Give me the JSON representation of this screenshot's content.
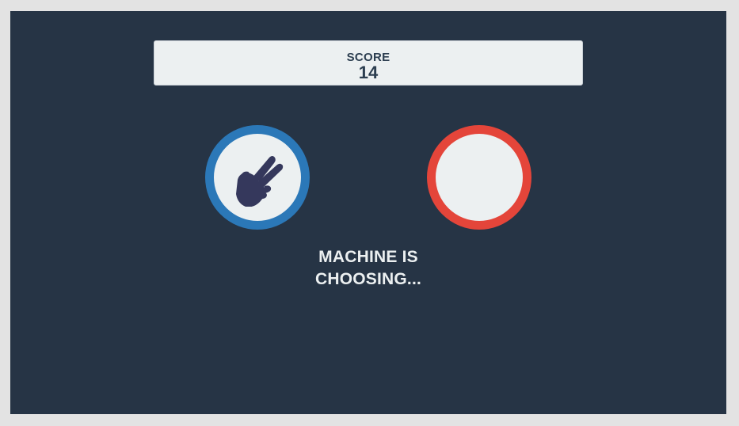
{
  "score": {
    "label": "SCORE",
    "value": "14"
  },
  "player": {
    "choice_icon": "scissors-hand-icon",
    "ring_color": "#2b78b8",
    "icon_color": "#35385c"
  },
  "machine": {
    "choice_icon": "",
    "ring_color": "#e4453a"
  },
  "status": {
    "line1": "MACHINE IS",
    "line2": "CHOOSING..."
  },
  "colors": {
    "background": "#263445",
    "panel": "#ecf0f1",
    "text_dark": "#2c3e50",
    "text_light": "#ecf0f1"
  }
}
